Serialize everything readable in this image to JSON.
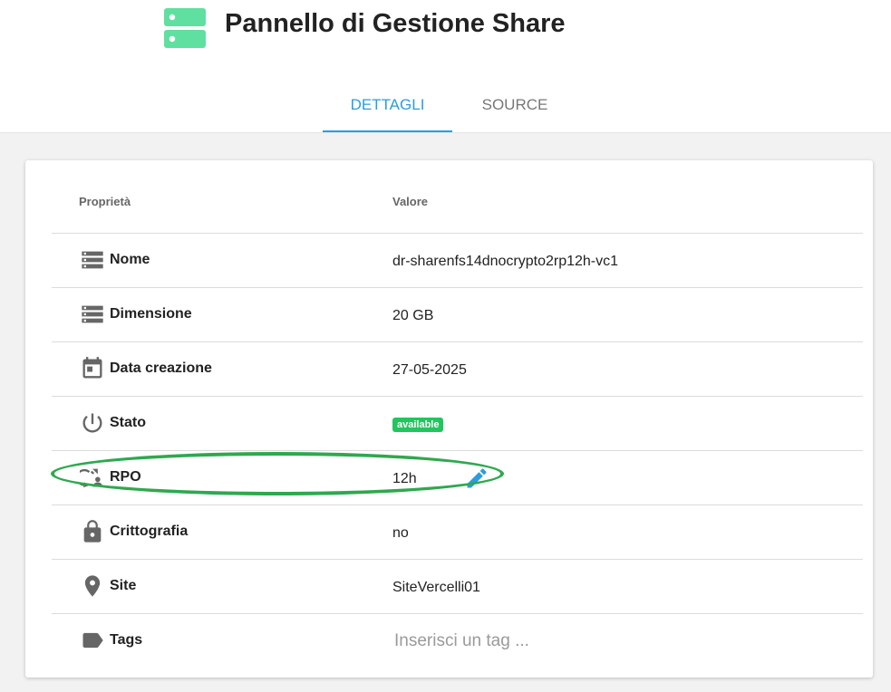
{
  "header": {
    "title": "Pannello di Gestione Share",
    "logo_icon": "server-icon",
    "logo_color": "#5fe0a0"
  },
  "tabs": [
    {
      "label": "DETTAGLI",
      "active": true
    },
    {
      "label": "SOURCE",
      "active": false
    }
  ],
  "accent_color": "#2d9cdb",
  "table": {
    "headers": {
      "property": "Proprietà",
      "value": "Valore"
    },
    "rows": [
      {
        "icon": "storage-icon",
        "name": "Nome",
        "value": "dr-sharenfs14dnocrypto2rp12h-vc1"
      },
      {
        "icon": "storage-icon",
        "name": "Dimensione",
        "value": "20 GB"
      },
      {
        "icon": "calendar-icon",
        "name": "Data creazione",
        "value": "27-05-2025"
      },
      {
        "icon": "power-icon",
        "name": "Stato",
        "value": "available",
        "badge_color": "#22c55e"
      },
      {
        "icon": "backup-restore-icon",
        "name": "RPO",
        "value": "12h",
        "action_icon": "pencil-icon"
      },
      {
        "icon": "lock-icon",
        "name": "Crittografia",
        "value": "no"
      },
      {
        "icon": "location-pin-icon",
        "name": "Site",
        "value": "SiteVercelli01"
      },
      {
        "icon": "tag-icon",
        "name": "Tags",
        "value": "",
        "placeholder": "Inserisci un tag ..."
      }
    ]
  },
  "highlight": {
    "target": "RPO",
    "color": "#2fa84f"
  }
}
